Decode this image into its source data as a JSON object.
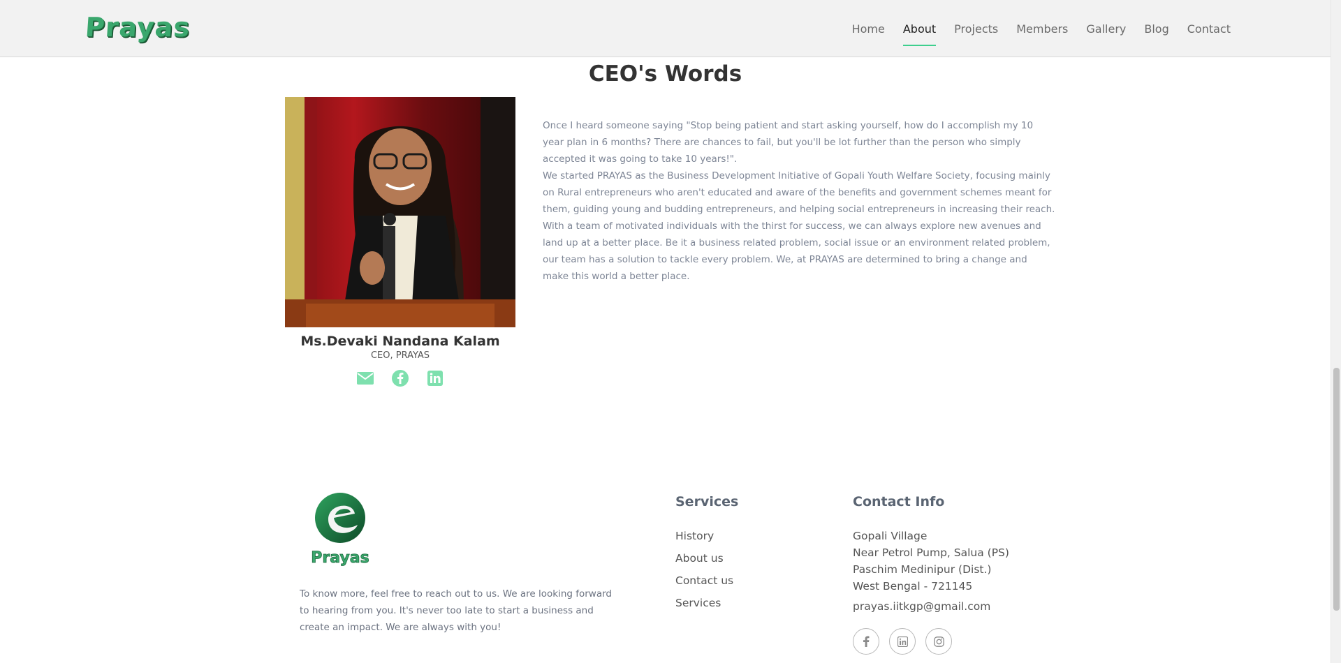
{
  "header": {
    "logo_text": "Prayas",
    "nav": [
      {
        "label": "Home"
      },
      {
        "label": "About"
      },
      {
        "label": "Projects"
      },
      {
        "label": "Members"
      },
      {
        "label": "Gallery"
      },
      {
        "label": "Blog"
      },
      {
        "label": "Contact"
      }
    ],
    "active_nav": "About"
  },
  "ceo": {
    "section_title": "CEO's Words",
    "name": "Ms.Devaki Nandana Kalam",
    "role": "CEO, PRAYAS",
    "social_icons": [
      "envelope-icon",
      "facebook-icon",
      "linkedin-icon"
    ],
    "quote_p1": "Once I heard someone saying \"Stop being patient and start asking yourself, how do I accomplish my 10 year plan in 6 months? There are chances to fail, but you'll be lot further than the person who simply accepted it was going to take 10 years!\".",
    "quote_p2": "We started PRAYAS as the Business Development Initiative of Gopali Youth Welfare Society, focusing mainly on Rural entrepreneurs who aren't educated and aware of the benefits and government schemes meant for them, guiding young and budding entrepreneurs, and helping social entrepreneurs in increasing their reach. With a team of motivated individuals with the thirst for success, we can always explore new avenues and land up at a better place. Be it a business related problem, social issue or an environment related problem, our team has a solution to tackle every problem. We, at PRAYAS are determined to bring a change and make this world a better place."
  },
  "footer": {
    "logo_text": "Prayas",
    "description": "To know more, feel free to reach out to us. We are looking forward to hearing from you. It's never too late to start a business and create an impact. We are always with you!",
    "services_title": "Services",
    "services": [
      "History",
      "About us",
      "Contact us",
      "Services"
    ],
    "contact_title": "Contact Info",
    "address": [
      "Gopali Village",
      "Near Petrol Pump, Salua (PS)",
      "Paschim Medinipur (Dist.)",
      "West Bengal - 721145"
    ],
    "email": "prayas.iitkgp@gmail.com",
    "social_icons": [
      "facebook-icon",
      "linkedin-icon",
      "instagram-icon"
    ]
  },
  "colors": {
    "accent": "#3ecf8e",
    "icon_green": "#7ee0ae",
    "logo_green": "#3aa76d",
    "muted_text": "#7d8595"
  }
}
